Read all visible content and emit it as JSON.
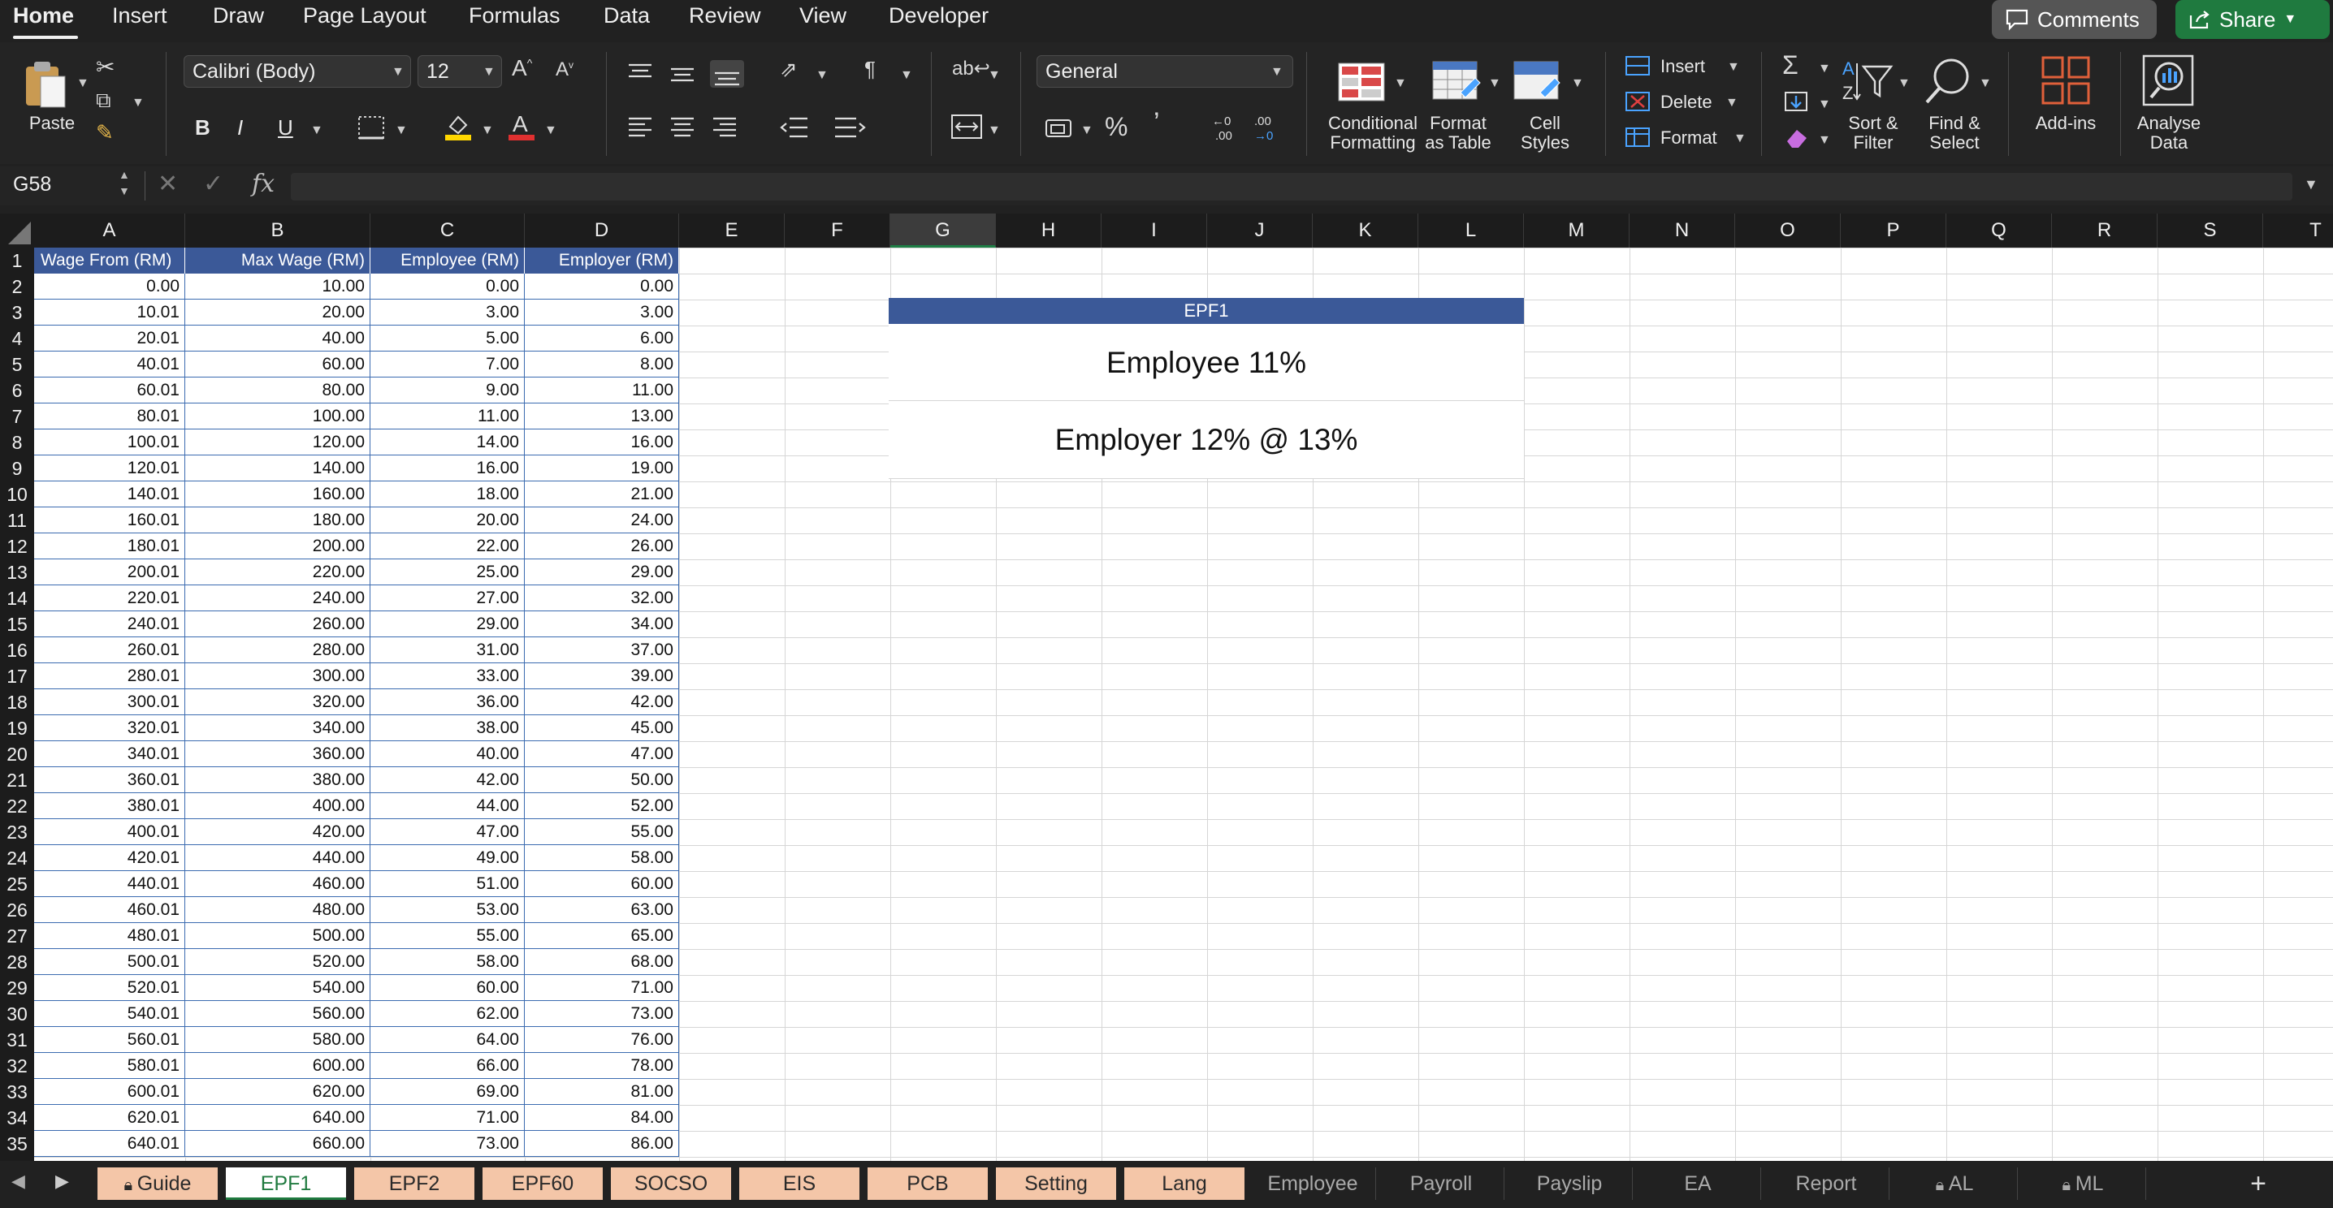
{
  "menu": {
    "items": [
      "Home",
      "Insert",
      "Draw",
      "Page Layout",
      "Formulas",
      "Data",
      "Review",
      "View",
      "Developer"
    ],
    "comments_label": "Comments",
    "share_label": "Share"
  },
  "ribbon": {
    "paste_label": "Paste",
    "font_name": "Calibri (Body)",
    "font_size": "12",
    "number_format": "General",
    "bold": "B",
    "italic": "I",
    "underline": "U",
    "conditional_formatting": [
      "Conditional",
      "Formatting"
    ],
    "format_as_table": [
      "Format",
      "as Table"
    ],
    "cell_styles": [
      "Cell",
      "Styles"
    ],
    "insert_label": "Insert",
    "delete_label": "Delete",
    "format_label": "Format",
    "sort_filter": [
      "Sort &",
      "Filter"
    ],
    "find_select": [
      "Find &",
      "Select"
    ],
    "add_ins": "Add-ins",
    "analyse_data": [
      "Analyse",
      "Data"
    ],
    "colors": {
      "highlight": "#ffd700",
      "font_color": "#e03030",
      "accent": "#1f7a3f"
    }
  },
  "formula_bar": {
    "name_box": "G58",
    "fx": "fx",
    "formula": ""
  },
  "grid": {
    "columns": [
      "A",
      "B",
      "C",
      "D",
      "E",
      "F",
      "G",
      "H",
      "I",
      "J",
      "K",
      "L",
      "M",
      "N",
      "O",
      "P",
      "Q",
      "R",
      "S",
      "T"
    ],
    "selected_column": "G",
    "rows": [
      "1",
      "2",
      "3",
      "4",
      "5",
      "6",
      "7",
      "8",
      "9",
      "10",
      "11",
      "12",
      "13",
      "14",
      "15",
      "16",
      "17",
      "18",
      "19",
      "20",
      "21",
      "22",
      "23",
      "24",
      "25",
      "26",
      "27",
      "28",
      "29",
      "30",
      "31",
      "32",
      "33",
      "34",
      "35"
    ],
    "table_headers": [
      "Wage From (RM)",
      "Max Wage (RM)",
      "Employee (RM)",
      "Employer (RM)"
    ],
    "table_rows": [
      [
        "0.00",
        "10.00",
        "0.00",
        "0.00"
      ],
      [
        "10.01",
        "20.00",
        "3.00",
        "3.00"
      ],
      [
        "20.01",
        "40.00",
        "5.00",
        "6.00"
      ],
      [
        "40.01",
        "60.00",
        "7.00",
        "8.00"
      ],
      [
        "60.01",
        "80.00",
        "9.00",
        "11.00"
      ],
      [
        "80.01",
        "100.00",
        "11.00",
        "13.00"
      ],
      [
        "100.01",
        "120.00",
        "14.00",
        "16.00"
      ],
      [
        "120.01",
        "140.00",
        "16.00",
        "19.00"
      ],
      [
        "140.01",
        "160.00",
        "18.00",
        "21.00"
      ],
      [
        "160.01",
        "180.00",
        "20.00",
        "24.00"
      ],
      [
        "180.01",
        "200.00",
        "22.00",
        "26.00"
      ],
      [
        "200.01",
        "220.00",
        "25.00",
        "29.00"
      ],
      [
        "220.01",
        "240.00",
        "27.00",
        "32.00"
      ],
      [
        "240.01",
        "260.00",
        "29.00",
        "34.00"
      ],
      [
        "260.01",
        "280.00",
        "31.00",
        "37.00"
      ],
      [
        "280.01",
        "300.00",
        "33.00",
        "39.00"
      ],
      [
        "300.01",
        "320.00",
        "36.00",
        "42.00"
      ],
      [
        "320.01",
        "340.00",
        "38.00",
        "45.00"
      ],
      [
        "340.01",
        "360.00",
        "40.00",
        "47.00"
      ],
      [
        "360.01",
        "380.00",
        "42.00",
        "50.00"
      ],
      [
        "380.01",
        "400.00",
        "44.00",
        "52.00"
      ],
      [
        "400.01",
        "420.00",
        "47.00",
        "55.00"
      ],
      [
        "420.01",
        "440.00",
        "49.00",
        "58.00"
      ],
      [
        "440.01",
        "460.00",
        "51.00",
        "60.00"
      ],
      [
        "460.01",
        "480.00",
        "53.00",
        "63.00"
      ],
      [
        "480.01",
        "500.00",
        "55.00",
        "65.00"
      ],
      [
        "500.01",
        "520.00",
        "58.00",
        "68.00"
      ],
      [
        "520.01",
        "540.00",
        "60.00",
        "71.00"
      ],
      [
        "540.01",
        "560.00",
        "62.00",
        "73.00"
      ],
      [
        "560.01",
        "580.00",
        "64.00",
        "76.00"
      ],
      [
        "580.01",
        "600.00",
        "66.00",
        "78.00"
      ],
      [
        "600.01",
        "620.00",
        "69.00",
        "81.00"
      ],
      [
        "620.01",
        "640.00",
        "71.00",
        "84.00"
      ],
      [
        "640.01",
        "660.00",
        "73.00",
        "86.00"
      ]
    ],
    "info_box": {
      "title": "EPF1",
      "line1": "Employee 11%",
      "line2": "Employer 12% @ 13%"
    },
    "header_color": "#3b5998"
  },
  "sheet_tabs": {
    "tabs": [
      "Guide",
      "EPF1",
      "EPF2",
      "EPF60",
      "SOCSO",
      "EIS",
      "PCB",
      "Setting",
      "Lang",
      "Employee",
      "Payroll",
      "Payslip",
      "EA",
      "Report",
      "AL",
      "ML"
    ],
    "active": "EPF1",
    "locked": [
      "Guide",
      "AL",
      "ML"
    ],
    "add_label": "+"
  }
}
